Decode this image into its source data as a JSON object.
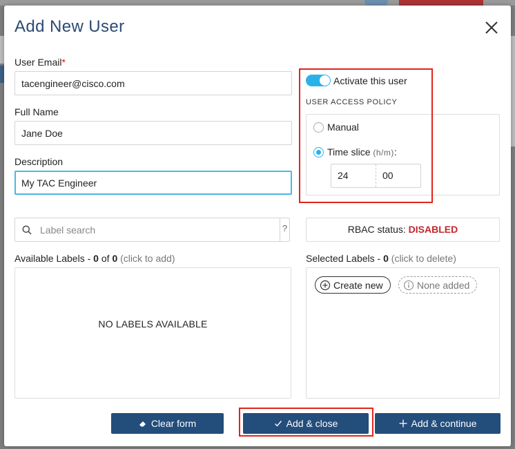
{
  "modal": {
    "title": "Add New User"
  },
  "form": {
    "email": {
      "label": "User Email",
      "required_mark": "*",
      "value": "tacengineer@cisco.com"
    },
    "full_name": {
      "label": "Full Name",
      "value": "Jane Doe"
    },
    "description": {
      "label": "Description",
      "value": "My TAC Engineer"
    }
  },
  "activation": {
    "label": "Activate this user",
    "active": true
  },
  "access_policy": {
    "heading": "USER ACCESS POLICY",
    "options": [
      {
        "label": "Manual",
        "selected": false
      },
      {
        "label": "Time slice",
        "hint": "(h/m)",
        "suffix": ":",
        "selected": true
      }
    ],
    "time_slice": {
      "hours": "24",
      "minutes": "00"
    }
  },
  "label_search": {
    "placeholder": "Label search",
    "help": "?"
  },
  "rbac": {
    "label": "RBAC status:",
    "status": "DISABLED"
  },
  "available_labels": {
    "title": "Available Labels",
    "sep": "-",
    "shown": "0",
    "of_word": "of",
    "total": "0",
    "hint": "(click to add)",
    "empty_text": "NO LABELS AVAILABLE"
  },
  "selected_labels": {
    "title": "Selected Labels",
    "sep": "-",
    "count": "0",
    "hint": "(click to delete)",
    "create_label": "Create new",
    "none_label": "None added"
  },
  "buttons": {
    "clear": "Clear form",
    "add_close": "Add & close",
    "add_continue": "Add & continue"
  },
  "colors": {
    "accent": "#2ab2e8",
    "primary_button": "#234d7b",
    "title": "#2c4a72",
    "status_disabled": "#c0262c",
    "highlight_box": "#e2231a"
  }
}
